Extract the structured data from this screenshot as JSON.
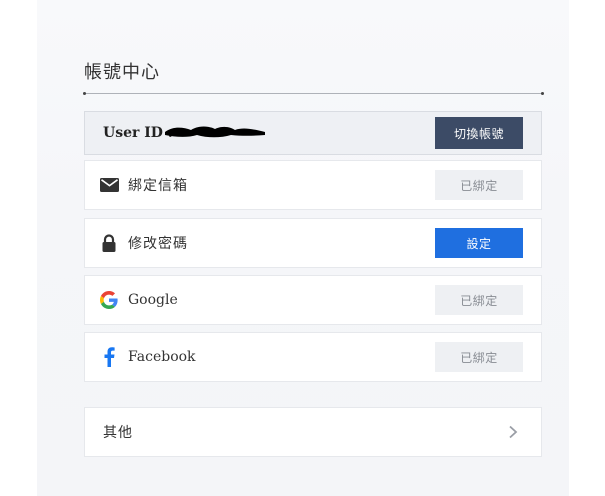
{
  "page": {
    "title": "帳號中心"
  },
  "account": {
    "user_id_label": "User ID :",
    "switch_button": "切換帳號"
  },
  "items": [
    {
      "label": "綁定信箱",
      "button": "已綁定",
      "icon": "mail-icon"
    },
    {
      "label": "修改密碼",
      "button": "設定",
      "icon": "lock-icon"
    },
    {
      "label": "Google",
      "button": "已綁定",
      "icon": "google-icon"
    },
    {
      "label": "Facebook",
      "button": "已綁定",
      "icon": "facebook-icon"
    }
  ],
  "other": {
    "label": "其他",
    "icon": "chevron-right-icon"
  },
  "colors": {
    "primary": "#1f6fe0",
    "dark_button": "#3c4b66",
    "bound_button_bg": "#eef0f3",
    "google_blue": "#4285F4",
    "google_red": "#EA4335",
    "google_yellow": "#FBBC05",
    "google_green": "#34A853",
    "facebook_blue": "#1877F2"
  }
}
